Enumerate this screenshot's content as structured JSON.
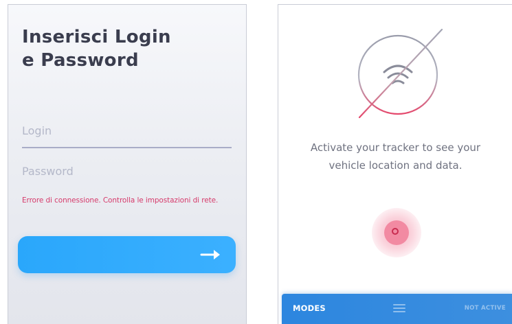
{
  "login_screen": {
    "title_line1": "Inserisci Login",
    "title_line2": "e Password",
    "login_placeholder": "Login",
    "password_placeholder": "Password",
    "error_message": "Errore di connessione. Controlla le impostazioni di rete.",
    "submit_icon": "arrow-right-icon",
    "colors": {
      "button": "#2aa7fb",
      "error": "#d63a6a",
      "title": "#3a3d4e"
    }
  },
  "tracker_screen": {
    "status_icon": "tracker-off-icon",
    "message_line1": "Activate your tracker to see your",
    "message_line2": "vehicle location and data.",
    "activate_icon": "power-circle-icon",
    "bottom_bar": {
      "modes_label": "MODES",
      "menu_icon": "menu-icon",
      "status_label": "NOT ACTIVE"
    },
    "colors": {
      "bar": "#2c86df",
      "accent": "#e2456a"
    }
  }
}
